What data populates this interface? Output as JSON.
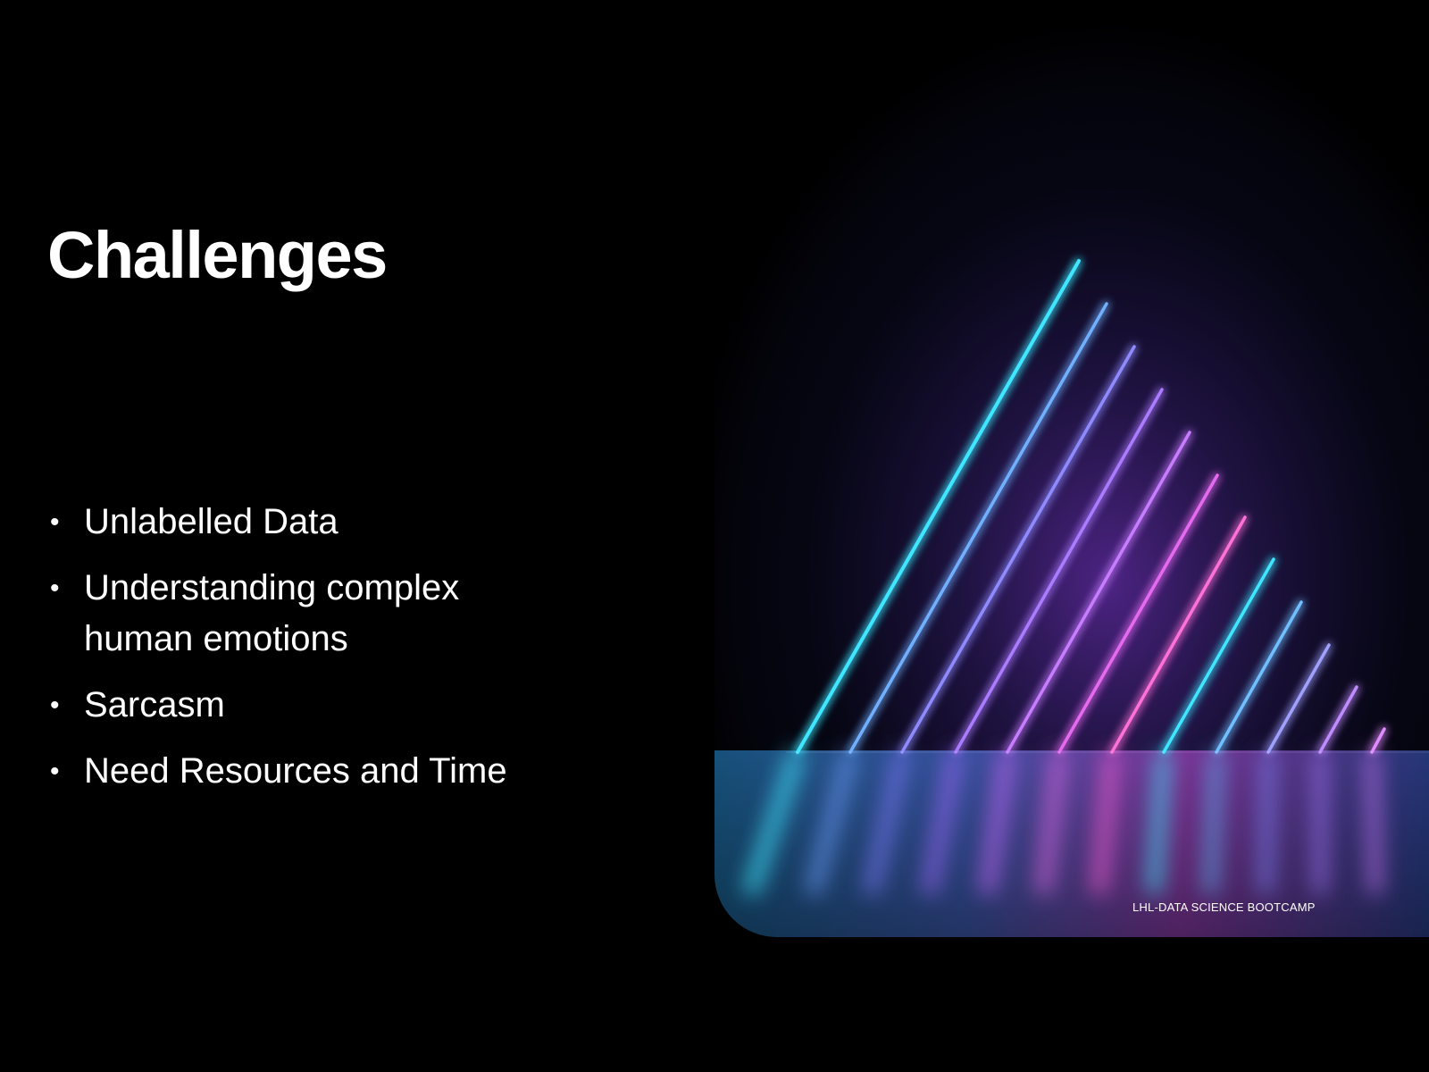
{
  "slide": {
    "title": "Challenges",
    "bullets": [
      "Unlabelled Data",
      "Understanding complex human emotions",
      "Sarcasm",
      "Need Resources and Time"
    ],
    "bullet_symbol": "•",
    "footer": "LHL-DATA SCIENCE BOOTCAMP"
  },
  "image": {
    "description_icon": "neon-triangle-image",
    "colors": {
      "background": "#000000",
      "neon_cyan": "#3fe6ff",
      "neon_blue": "#6f7bff",
      "neon_violet": "#b56bff",
      "neon_pink": "#ff5fd6",
      "text": "#ffffff"
    }
  }
}
